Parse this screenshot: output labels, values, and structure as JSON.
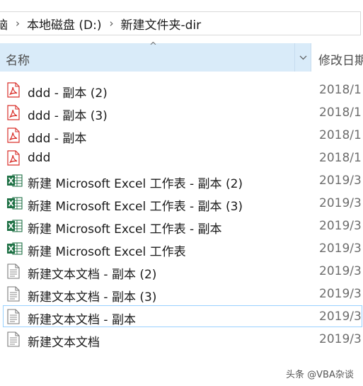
{
  "breadcrumb": {
    "items": [
      "脑",
      "本地磁盘 (D:)",
      "新建文件夹-dir"
    ]
  },
  "columns": {
    "name_label": "名称",
    "date_label": "修改日期",
    "sort_indicator": "^",
    "dropdown_icon": "chevron-down-icon"
  },
  "files": [
    {
      "name": "ddd - 副本 (2)",
      "date": "2018/1",
      "type": "pdf"
    },
    {
      "name": "ddd - 副本 (3)",
      "date": "2018/1",
      "type": "pdf"
    },
    {
      "name": "ddd - 副本",
      "date": "2018/1",
      "type": "pdf"
    },
    {
      "name": "ddd",
      "date": "2018/1",
      "type": "pdf"
    },
    {
      "name": "新建 Microsoft Excel 工作表 - 副本 (2)",
      "date": "2019/3",
      "type": "excel"
    },
    {
      "name": "新建 Microsoft Excel 工作表 - 副本 (3)",
      "date": "2019/3",
      "type": "excel"
    },
    {
      "name": "新建 Microsoft Excel 工作表 - 副本",
      "date": "2019/3",
      "type": "excel"
    },
    {
      "name": "新建 Microsoft Excel 工作表",
      "date": "2019/3",
      "type": "excel"
    },
    {
      "name": "新建文本文档 - 副本 (2)",
      "date": "2019/3",
      "type": "text"
    },
    {
      "name": "新建文本文档 - 副本 (3)",
      "date": "2019/3",
      "type": "text"
    },
    {
      "name": "新建文本文档 - 副本",
      "date": "2019/3",
      "type": "text",
      "selected": true
    },
    {
      "name": "新建文本文档",
      "date": "2019/3",
      "type": "text"
    }
  ],
  "watermark": "头条 @VBA杂谈",
  "colors": {
    "header_bg": "#d9ebf9",
    "selection_border": "#99d1ff",
    "pdf_red": "#d9302b",
    "excel_green": "#1e7145"
  }
}
